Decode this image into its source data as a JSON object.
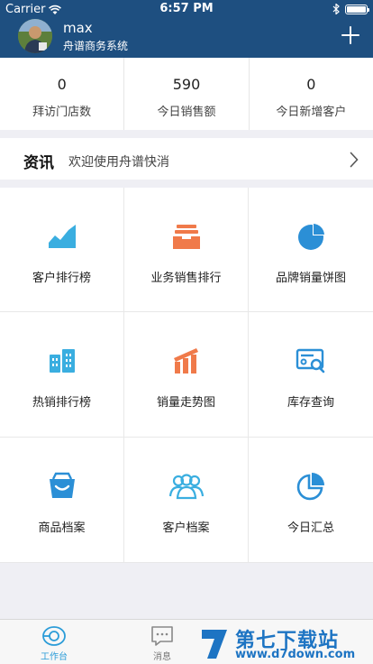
{
  "status_bar": {
    "carrier": "Carrier",
    "time": "6:57 PM",
    "battery_level": 1.0
  },
  "header": {
    "user_name": "max",
    "organization": "舟谱商务系统",
    "add_icon": "plus-icon"
  },
  "stats": [
    {
      "value": "0",
      "label": "拜访门店数"
    },
    {
      "value": "590",
      "label": "今日销售额"
    },
    {
      "value": "0",
      "label": "今日新增客户"
    }
  ],
  "news": {
    "title": "资讯",
    "text": "欢迎使用舟谱快消"
  },
  "menu": [
    {
      "label": "客户排行榜",
      "icon": "area-chart-icon",
      "color": "#3aaee0"
    },
    {
      "label": "业务销售排行",
      "icon": "tray-icon",
      "color": "#f07a4a"
    },
    {
      "label": "品牌销量饼图",
      "icon": "pie-chart-icon",
      "color": "#2b8fd6"
    },
    {
      "label": "热销排行榜",
      "icon": "building-icon",
      "color": "#3aaee0"
    },
    {
      "label": "销量走势图",
      "icon": "trend-bar-icon",
      "color": "#f07a4a"
    },
    {
      "label": "库存查询",
      "icon": "inventory-search-icon",
      "color": "#2b8fd6"
    },
    {
      "label": "商品档案",
      "icon": "basket-icon",
      "color": "#2b8fd6"
    },
    {
      "label": "客户档案",
      "icon": "people-icon",
      "color": "#3aaee0"
    },
    {
      "label": "今日汇总",
      "icon": "summary-pie-icon",
      "color": "#2b8fd6"
    }
  ],
  "tabbar": {
    "accent": "#2b9cd8",
    "tabs": [
      {
        "label": "工作台",
        "icon": "workbench-icon",
        "active": true
      },
      {
        "label": "消息",
        "icon": "message-icon",
        "active": false
      }
    ]
  },
  "watermark": {
    "title": "第七下载站",
    "url": "www.d7down.com"
  }
}
